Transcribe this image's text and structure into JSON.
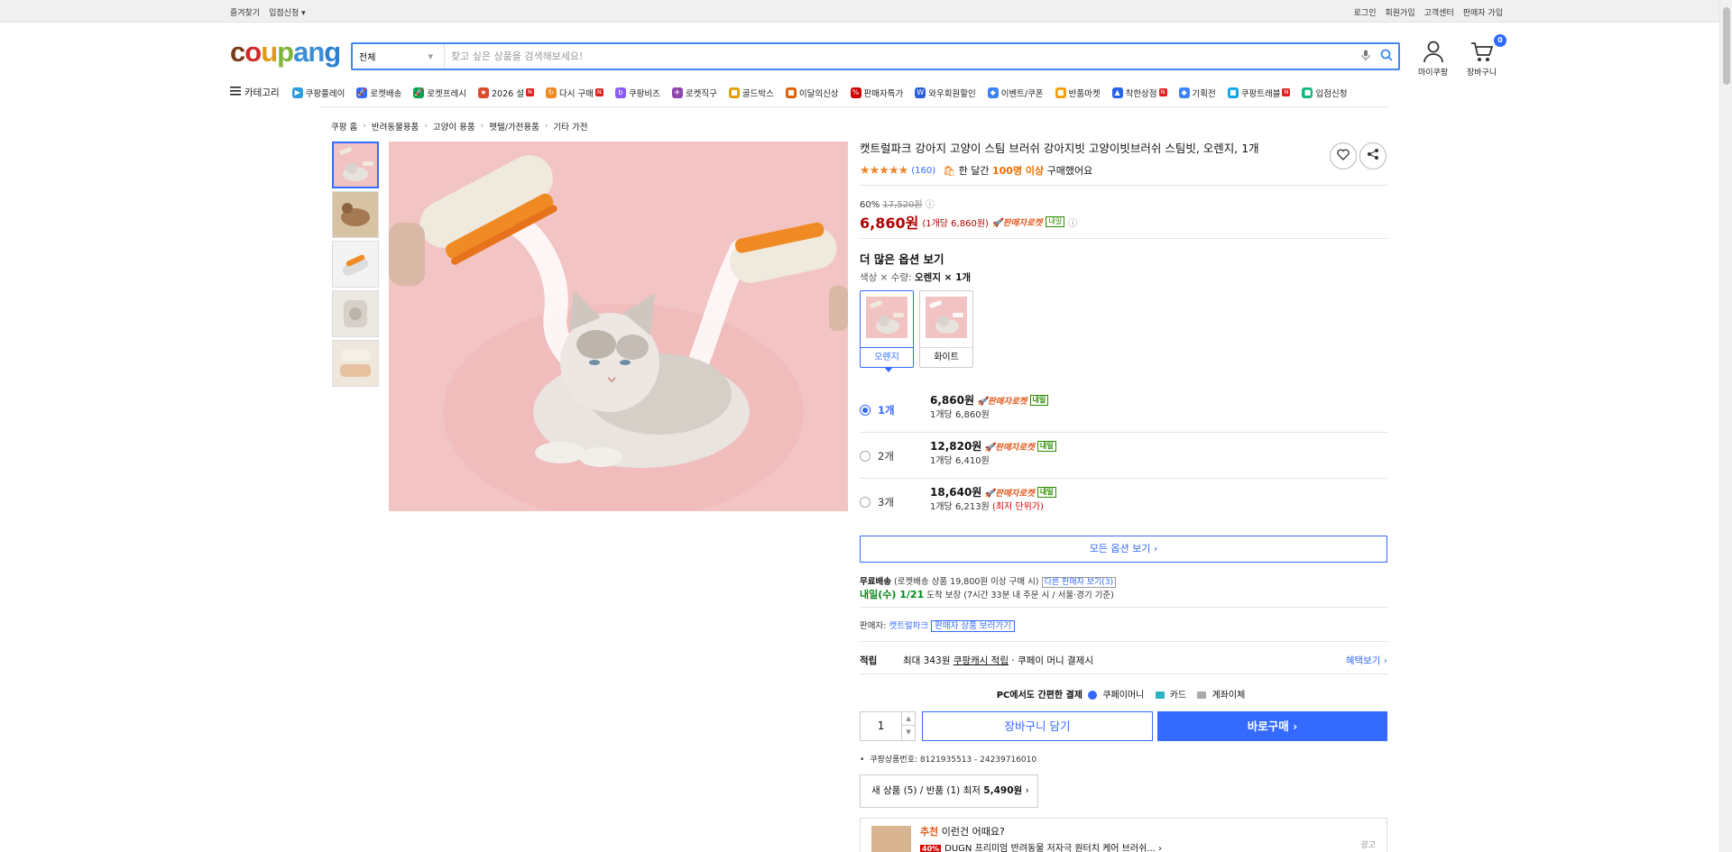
{
  "topbar": {
    "left": [
      "즐겨찾기",
      "입점신청 ▾"
    ],
    "right": [
      "로그인",
      "회원가입",
      "고객센터",
      "판매자 가입"
    ]
  },
  "logo": [
    "c",
    "o",
    "u",
    "p",
    "a",
    "n",
    "g"
  ],
  "search": {
    "category": "전체",
    "placeholder": "찾고 싶은 상품을 검색해보세요!"
  },
  "header": {
    "mypage": "마이쿠팡",
    "cart": "장바구니",
    "cart_count": "0"
  },
  "catbar": {
    "all": "카테고리",
    "items": [
      {
        "label": "쿠팡플레이",
        "icon": "▶",
        "color": "#2d9cdb",
        "badge": ""
      },
      {
        "label": "로켓배송",
        "icon": "🚀",
        "color": "#346aff",
        "badge": ""
      },
      {
        "label": "로켓프레시",
        "icon": "🚀",
        "color": "#00a651",
        "badge": ""
      },
      {
        "label": "2026 설",
        "icon": "★",
        "color": "#d94a2b",
        "badge": "N"
      },
      {
        "label": "다시 구매",
        "icon": "↻",
        "color": "#f08a24",
        "badge": "N"
      },
      {
        "label": "쿠팡비즈",
        "icon": "b",
        "color": "#8b5cf6",
        "badge": ""
      },
      {
        "label": "로켓직구",
        "icon": "✈",
        "color": "#8e44ad",
        "badge": ""
      },
      {
        "label": "골드박스",
        "icon": "■",
        "color": "#e0a100",
        "badge": ""
      },
      {
        "label": "이달의신상",
        "icon": "■",
        "color": "#e06000",
        "badge": ""
      },
      {
        "label": "판매자특가",
        "icon": "%",
        "color": "#d00000",
        "badge": ""
      },
      {
        "label": "와우회원할인",
        "icon": "W",
        "color": "#2b5fd9",
        "badge": ""
      },
      {
        "label": "이벤트/쿠폰",
        "icon": "◆",
        "color": "#3b82f6",
        "badge": ""
      },
      {
        "label": "반품마켓",
        "icon": "■",
        "color": "#f59e0b",
        "badge": ""
      },
      {
        "label": "착한상점",
        "icon": "▲",
        "color": "#2563eb",
        "badge": "N"
      },
      {
        "label": "기획전",
        "icon": "◆",
        "color": "#3b82f6",
        "badge": ""
      },
      {
        "label": "쿠팡트래블",
        "icon": "■",
        "color": "#0ea5e9",
        "badge": "N"
      },
      {
        "label": "입점신청",
        "icon": "■",
        "color": "#10b981",
        "badge": ""
      }
    ]
  },
  "breadcrumb": [
    "쿠팡 홈",
    "반려동물용품",
    "고양이 용품",
    "펫텔/가전용품",
    "기타 가전"
  ],
  "product": {
    "title": "캣트럴파크 강아지 고양이 스팀 브러쉬 강아지빗 고양이빗브러쉬 스팀빗, 오렌지, 1개",
    "rating_count": "(160)",
    "bought_pre": "한 달간 ",
    "bought_strong": "100명 이상",
    "bought_post": " 구매했어요",
    "discount": "60%",
    "original_price": "17,520원",
    "price": "6,860원",
    "unit_price": "(1개당 6,860원)",
    "rocket_label": "판매자로켓",
    "tomorrow": "내일",
    "more_options": "더 많은 옵션 보기",
    "selected_label": "색상 × 수량: ",
    "selected_value": "오렌지 × 1개",
    "colors": [
      "오렌지",
      "화이트"
    ]
  },
  "quantities": [
    {
      "count": "1개",
      "price": "6,860원",
      "per": "1개당 6,860원",
      "note": ""
    },
    {
      "count": "2개",
      "price": "12,820원",
      "per": "1개당 6,410원",
      "note": ""
    },
    {
      "count": "3개",
      "price": "18,640원",
      "per": "1개당 6,213원",
      "note": " (최저 단위가)"
    }
  ],
  "all_options": "모든 옵션 보기 ›",
  "shipping": {
    "free": "무료배송",
    "free_detail": " (로켓배송 상품 19,800원 이상 구매 시)",
    "other_sellers": "다른 판매자 보기(3)",
    "arrival": "내일(수) 1/21",
    "arrival_detail": " 도착 보장 (7시간 33분 내 주문 시 / 서울·경기 기준)"
  },
  "seller": {
    "label": "판매자: ",
    "name": "캣트럴파크",
    "link": "판매자 상품 보러가기"
  },
  "reward": {
    "label": "적립",
    "pre": "최대 343원 ",
    "link": "쿠팡캐시 적립",
    "post": " · 쿠페이 머니 결제시",
    "more": "혜택보기 ›"
  },
  "pay": {
    "title": "PC에서도 간편한 결제",
    "methods": [
      "쿠페이머니",
      "카드",
      "계좌이체"
    ]
  },
  "buy": {
    "qty": "1",
    "cart": "장바구니 담기",
    "buy": "바로구매 ›"
  },
  "product_id": "쿠팡상품번호: 8121935513 - 24239716010",
  "new_used": {
    "label": "새 상품 (5) / 반품 (1) 최저 ",
    "price": "5,490원",
    "arrow": " ›"
  },
  "recommend": {
    "title_strong": "추천",
    "title": " 이런건 어때요?",
    "pct": "40%",
    "text": "DUGN 프리미엄 반려동물 저자극 원터치 케어 브러쉬...  ›",
    "ad": "광고"
  }
}
